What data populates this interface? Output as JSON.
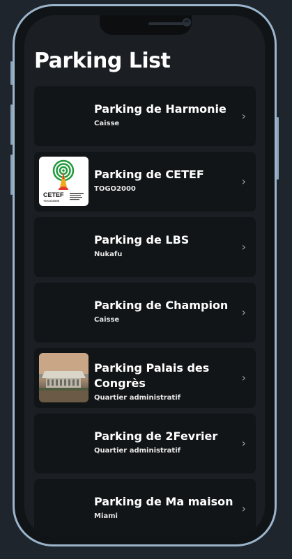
{
  "page": {
    "title": "Parking List"
  },
  "parkings": [
    {
      "name": "Parking de Harmonie",
      "subtitle": "Caisse",
      "thumb": "none"
    },
    {
      "name": "Parking de CETEF",
      "subtitle": "TOGO2000",
      "thumb": "logo",
      "logo_text": "CETEF",
      "logo_sub": "TOGO2000"
    },
    {
      "name": "Parking de LBS",
      "subtitle": "Nukafu",
      "thumb": "none"
    },
    {
      "name": "Parking de Champion",
      "subtitle": "Caisse",
      "thumb": "none"
    },
    {
      "name": "Parking Palais des Congrès",
      "subtitle": "Quartier administratif",
      "thumb": "photo"
    },
    {
      "name": "Parking de 2Fevrier",
      "subtitle": "Quartier administratif",
      "thumb": "none"
    },
    {
      "name": "Parking de Ma maison",
      "subtitle": "Miami",
      "thumb": "none"
    }
  ],
  "icons": {
    "row_arrow": "chevron-right-icon"
  },
  "colors": {
    "background": "#1b1f23",
    "card": "#121518",
    "frame": "#9bb5cc",
    "text": "#ffffff"
  }
}
